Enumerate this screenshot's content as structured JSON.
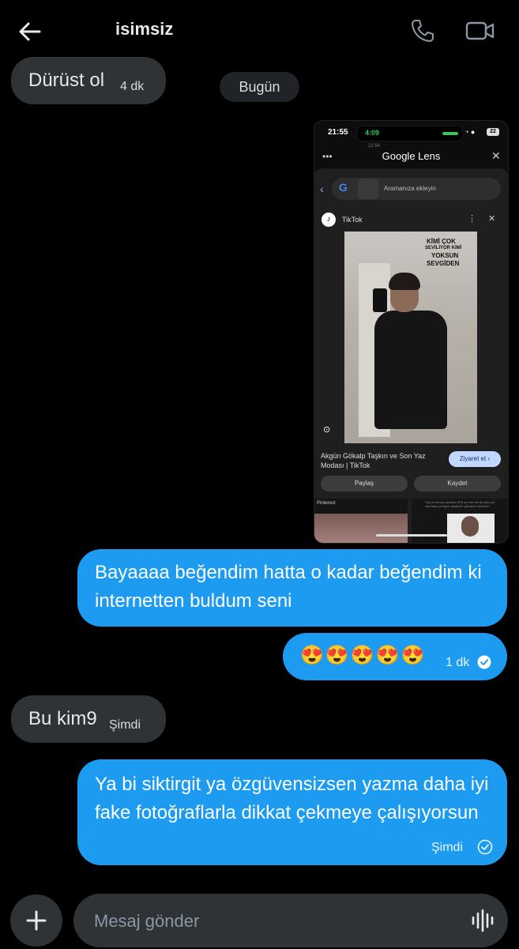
{
  "header": {
    "title": "isimsiz",
    "back_icon": "arrow-left-icon",
    "call_icon": "phone-icon",
    "video_icon": "video-camera-icon"
  },
  "messages": {
    "m1": {
      "text": "Dürüst ol",
      "time": "4 dk",
      "direction": "incoming"
    },
    "date_separator": "Bugün",
    "attachment": {
      "status_time": "21:55",
      "island_time": "4:09",
      "battery": "22",
      "sub_time": "21:54",
      "app_title": "Google Lens",
      "search_placeholder": "Aramanıza ekleyin",
      "source_name": "TikTok",
      "overlay_l1": "KİMİ ÇOK",
      "overlay_l2": "SEVİLİYOR KİMİ",
      "overlay_l3": "YOKSUN",
      "overlay_l4": "SEVGİDEN",
      "result_title": "Akgün Gökalp Taşkın ve Son Yaz Modası | TikTok",
      "visit_label": "Ziyaret et ›",
      "share_label": "Paylaş",
      "save_label": "Kaydet",
      "pin_label": "Pinterest",
      "card2_text": "Saç yıl olmuş sözlükte 9EŞ yıl arta tek bir gün yok aklımdan çıktığım aklgünler gökalpim taskinim"
    },
    "m2": {
      "text": "Bayaaaa beğendim hatta o kadar beğendim ki internetten buldum seni",
      "direction": "outgoing"
    },
    "m3": {
      "text": "😍😍😍😍😍",
      "time": "1 dk",
      "direction": "outgoing",
      "status": "seen"
    },
    "m4": {
      "text": "Bu kim9",
      "time": "Şimdi",
      "direction": "incoming"
    },
    "m5": {
      "text": "Ya bi siktirgit ya özgüvensizsen yazma daha iyi fake fotoğraflarla dikkat çekmeye çalışıyorsun",
      "time": "Şimdi",
      "direction": "outgoing",
      "status": "sent"
    }
  },
  "composer": {
    "placeholder": "Mesaj gönder",
    "plus_icon": "plus-icon",
    "voice_icon": "voice-waveform-icon"
  },
  "colors": {
    "background": "#000000",
    "incoming_bubble": "#2f3336",
    "outgoing_bubble": "#1d9bf0",
    "text": "#e7e9ea"
  }
}
